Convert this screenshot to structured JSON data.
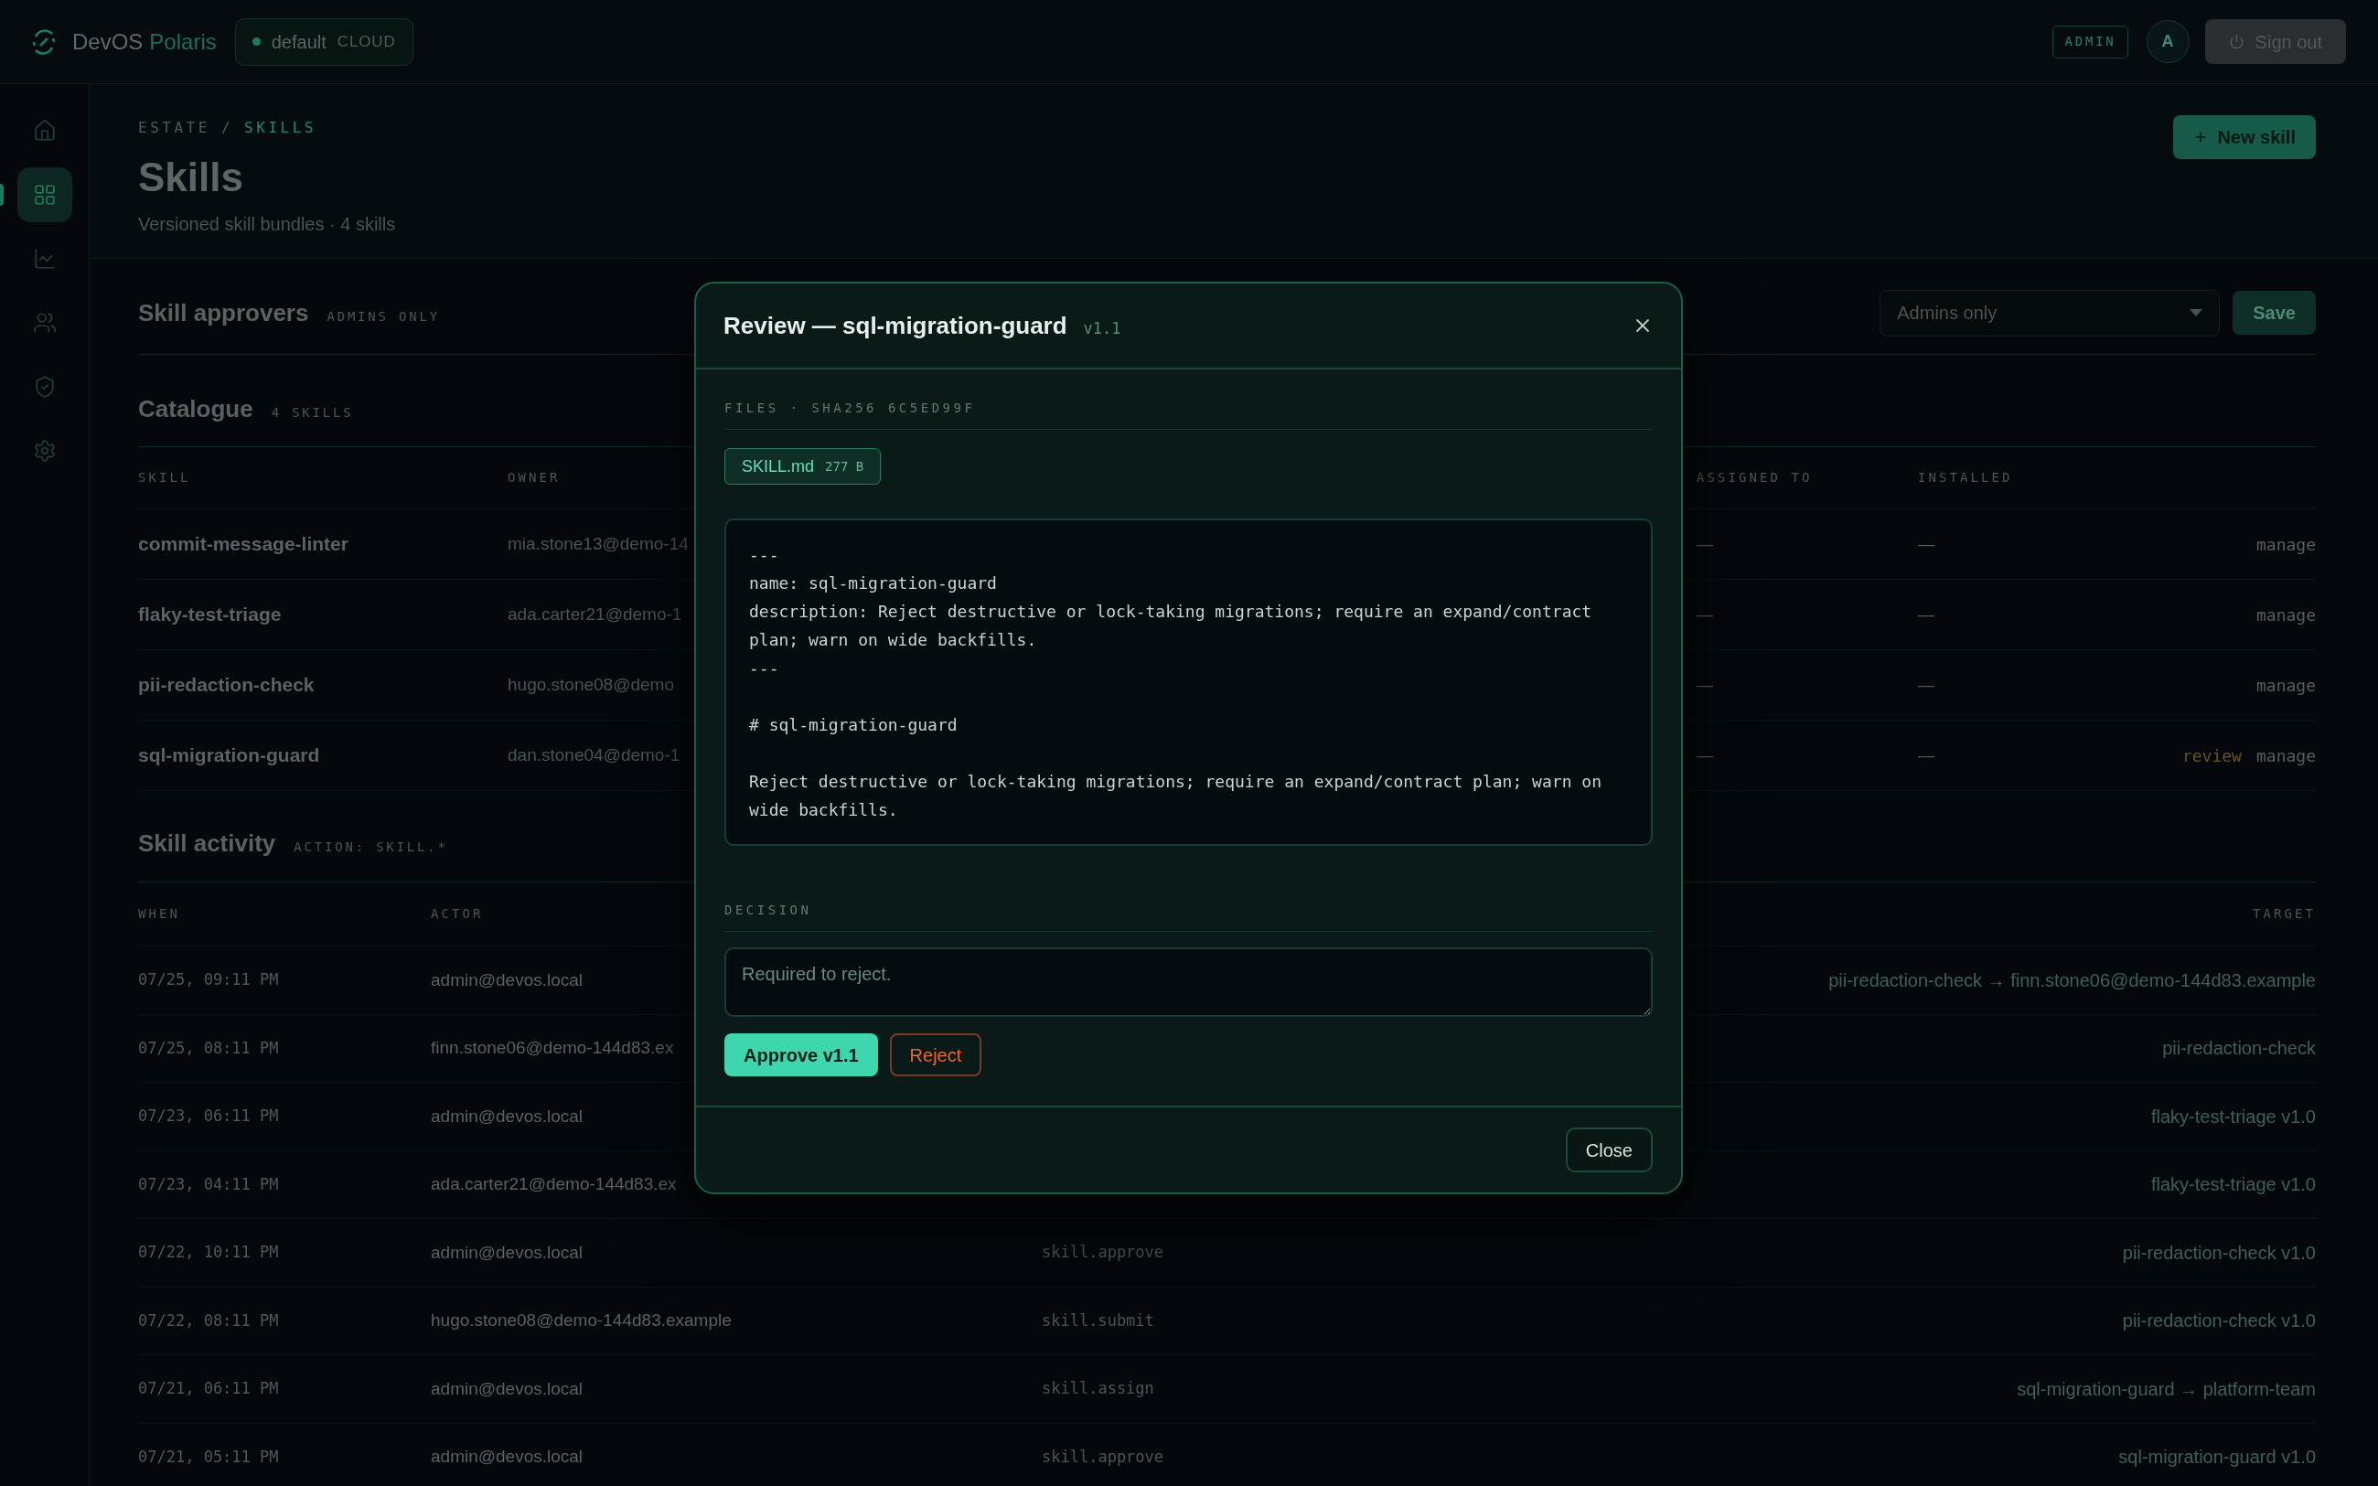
{
  "brand": {
    "name": "DevOS",
    "accent": "Polaris"
  },
  "workspace": {
    "name": "default",
    "tier": "CLOUD"
  },
  "top_bar": {
    "role_badge": "ADMIN",
    "avatar_initial": "A",
    "sign_out": "Sign out"
  },
  "sidebar": {
    "items": [
      {
        "kind": "home",
        "selected": false
      },
      {
        "kind": "grid",
        "selected": true
      },
      {
        "kind": "chart",
        "selected": false
      },
      {
        "kind": "users",
        "selected": false
      },
      {
        "kind": "shield",
        "selected": false
      },
      {
        "kind": "settings",
        "selected": false
      }
    ]
  },
  "breadcrumb": {
    "separator": "/",
    "items": [
      {
        "label": "ESTATE",
        "selected": false
      },
      {
        "label": "SKILLS",
        "selected": true
      }
    ]
  },
  "page": {
    "title": "Skills",
    "subtitle": "Versioned skill bundles · 4 skills",
    "new_button": "New skill"
  },
  "approvers": {
    "title": "Skill approvers",
    "tag": "ADMINS ONLY",
    "select_value": "Admins only",
    "save": "Save"
  },
  "catalogue": {
    "title": "Catalogue",
    "tag": "4 SKILLS",
    "columns": [
      "SKILL",
      "OWNER",
      "ASSIGNED TO",
      "INSTALLED"
    ],
    "rows": [
      {
        "skill": "commit-message-linter",
        "owner": "mia.stone13@demo-14",
        "assigned_to": "—",
        "installed": "—",
        "actions": [
          {
            "kind": "manage",
            "label": "manage"
          }
        ]
      },
      {
        "skill": "flaky-test-triage",
        "owner": "ada.carter21@demo-1",
        "assigned_to": "—",
        "installed": "—",
        "actions": [
          {
            "kind": "manage",
            "label": "manage"
          }
        ]
      },
      {
        "skill": "pii-redaction-check",
        "owner": "hugo.stone08@demo",
        "assigned_to": "—",
        "installed": "—",
        "actions": [
          {
            "kind": "manage",
            "label": "manage"
          }
        ]
      },
      {
        "skill": "sql-migration-guard",
        "owner": "dan.stone04@demo-1",
        "assigned_to": "—",
        "installed": "—",
        "actions": [
          {
            "kind": "review",
            "label": "review"
          },
          {
            "kind": "manage",
            "label": "manage"
          }
        ]
      }
    ]
  },
  "activity": {
    "title": "Skill activity",
    "tag": "ACTION: SKILL.*",
    "columns": {
      "when": "WHEN",
      "actor": "ACTOR",
      "target": "TARGET"
    },
    "rows": [
      {
        "when": "07/25, 09:11 PM",
        "actor": "admin@devos.local",
        "target": "pii-redaction-check → finn.stone06@demo-144d83.example"
      },
      {
        "when": "07/25, 08:11 PM",
        "actor": "finn.stone06@demo-144d83.ex",
        "target": "pii-redaction-check"
      },
      {
        "when": "07/23, 06:11 PM",
        "actor": "admin@devos.local",
        "target": "flaky-test-triage v1.0"
      },
      {
        "when": "07/23, 04:11 PM",
        "actor": "ada.carter21@demo-144d83.ex",
        "target": "flaky-test-triage v1.0"
      },
      {
        "when": "07/22, 10:11 PM",
        "actor": "admin@devos.local",
        "action": "skill.approve",
        "target": "pii-redaction-check v1.0"
      },
      {
        "when": "07/22, 08:11 PM",
        "actor": "hugo.stone08@demo-144d83.example",
        "action": "skill.submit",
        "target": "pii-redaction-check v1.0"
      },
      {
        "when": "07/21, 06:11 PM",
        "actor": "admin@devos.local",
        "action": "skill.assign",
        "target": "sql-migration-guard → platform-team"
      },
      {
        "when": "07/21, 05:11 PM",
        "actor": "admin@devos.local",
        "action": "skill.approve",
        "target": "sql-migration-guard v1.0"
      }
    ]
  },
  "dialog": {
    "title": "Review — sql-migration-guard",
    "version": "v1.1",
    "files_label": "FILES · SHA256 6C5ED99F",
    "files": [
      {
        "name": "SKILL.md",
        "size": "277 B",
        "selected": true
      }
    ],
    "content": "---\nname: sql-migration-guard\ndescription: Reject destructive or lock-taking migrations; require an expand/contract plan; warn on wide backfills.\n---\n\n# sql-migration-guard\n\nReject destructive or lock-taking migrations; require an expand/contract plan; warn on wide backfills.",
    "decision_label": "DECISION",
    "decision_placeholder": "Required to reject.",
    "approve": "Approve v1.1",
    "reject": "Reject",
    "close": "Close"
  }
}
